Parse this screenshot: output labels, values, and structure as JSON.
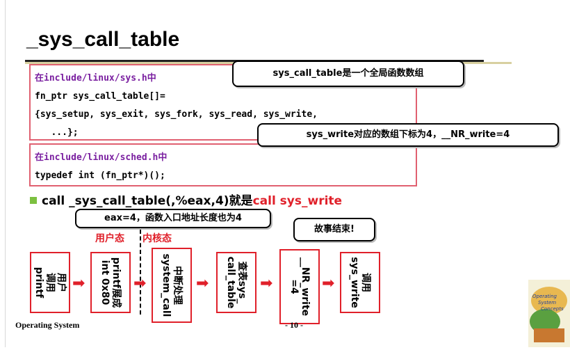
{
  "slide": {
    "title": "_sys_call_table",
    "code_block_1": {
      "lines": [
        "在include/linux/sys.h中",
        "fn_ptr sys_call_table[]=",
        "{sys_setup, sys_exit, sys_fork, sys_read, sys_write,",
        "   ...};"
      ]
    },
    "code_block_2": {
      "lines": [
        "在include/linux/sched.h中",
        "typedef int (fn_ptr*)();"
      ]
    },
    "callouts": {
      "global_array": "sys_call_table是一个全局函数数组",
      "index": "sys_write对应的数组下标为4，__NR_write=4",
      "entry_len": "eax=4，函数入口地址长度也为4",
      "end": "故事结束!"
    },
    "statement": {
      "part1": "call _sys_call_table(,%eax,4)",
      "part2": "就是",
      "part3": "call sys_write"
    },
    "modes": {
      "user": "用户态",
      "kernel": "内核态"
    },
    "flow_steps": [
      "用户\n调用\nprintf",
      "printf展成\nint 0x80",
      "中断处理\nsystem_call",
      "查表sys_\ncall_table",
      "__NR_write\n=4",
      "调用\nsys_write"
    ],
    "footer": {
      "left": "Operating System",
      "page": "- 10 -"
    },
    "logo": {
      "text": "Operating System Concepts"
    },
    "colors": {
      "accent_red": "#e0202a",
      "box_border": "#e06070",
      "code_purple": "#7a1fa0",
      "bullet_green": "#7cc040"
    }
  }
}
